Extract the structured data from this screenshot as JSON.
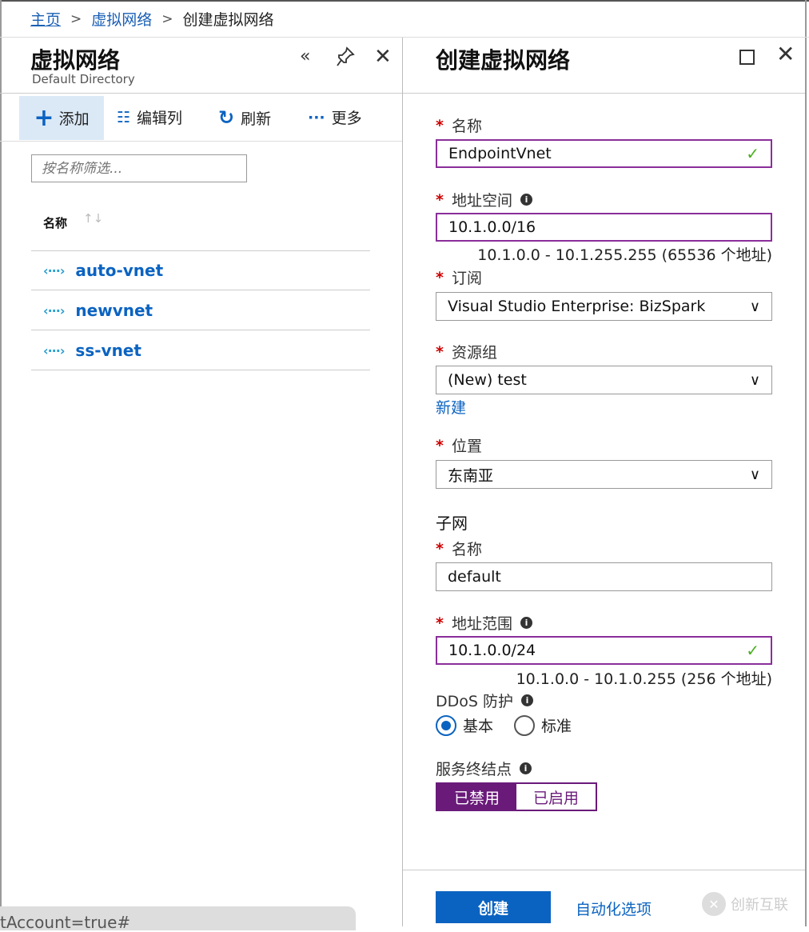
{
  "breadcrumb": {
    "home": "主页",
    "parent": "虚拟网络",
    "current": "创建虚拟网络",
    "sep": ">"
  },
  "left_blade": {
    "title": "虚拟网络",
    "subtitle": "Default Directory",
    "header_icons": {
      "collapse": "«",
      "pin": "⚲",
      "close": "✕"
    },
    "toolbar": {
      "add": "添加",
      "edit_columns": "编辑列",
      "refresh": "刷新",
      "more": "更多",
      "edit_icon": "☷",
      "refresh_icon": "↻",
      "more_icon": "···"
    },
    "filter_placeholder": "按名称筛选...",
    "column_header": "名称",
    "sort_glyph": "↑↓",
    "rows": [
      {
        "name": "auto-vnet"
      },
      {
        "name": "newvnet"
      },
      {
        "name": "ss-vnet"
      }
    ],
    "row_icon": "‹···›"
  },
  "url_fragment": "tAccount=true#",
  "right_blade": {
    "title": "创建虚拟网络",
    "name_label": "名称",
    "name_value": "EndpointVnet",
    "address_space_label": "地址空间",
    "address_space_value": "10.1.0.0/16",
    "address_space_hint": "10.1.0.0 - 10.1.255.255 (65536 个地址)",
    "subscription_label": "订阅",
    "subscription_value": "Visual Studio Enterprise: BizSpark",
    "resource_group_label": "资源组",
    "resource_group_value": "(New) test",
    "create_new_link": "新建",
    "location_label": "位置",
    "location_value": "东南亚",
    "subnet_section": "子网",
    "subnet_name_label": "名称",
    "subnet_name_value": "default",
    "subnet_range_label": "地址范围",
    "subnet_range_value": "10.1.0.0/24",
    "subnet_range_hint": "10.1.0.0 - 10.1.0.255 (256 个地址)",
    "ddos_label": "DDoS 防护",
    "ddos_basic": "基本",
    "ddos_standard": "标准",
    "service_endpoints_label": "服务终结点",
    "disabled": "已禁用",
    "enabled": "已启用",
    "create_button": "创建",
    "automation_link": "自动化选项",
    "required_mark": "*",
    "check": "✓",
    "chevron": "∨",
    "info": "i"
  },
  "watermark": "创新互联",
  "colors": {
    "accent_blue": "#0b63c1",
    "purple": "#6a1b7a",
    "required_red": "#cc0000",
    "valid_green": "#4caf22"
  }
}
